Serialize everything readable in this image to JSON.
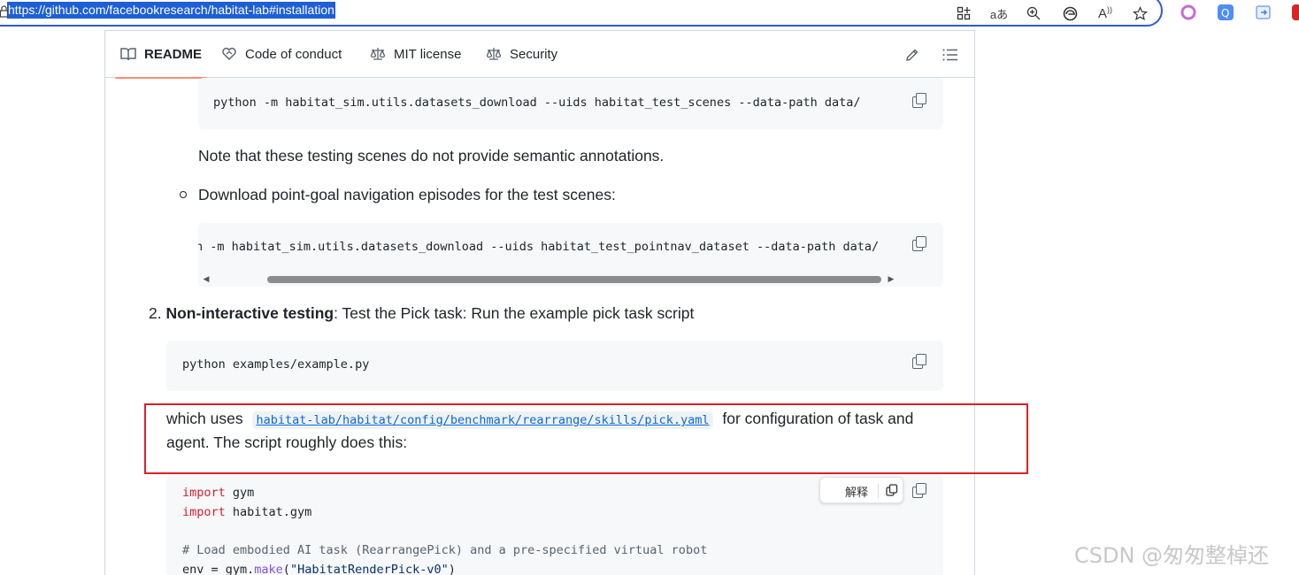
{
  "browser": {
    "url": "https://github.com/facebookresearch/habitat-lab#installation",
    "icons": [
      "apps-icon",
      "translate-icon",
      "zoom-icon",
      "edge-icon",
      "read-aloud-icon",
      "favorite-icon"
    ],
    "translate_label": "aあ",
    "read_aloud_label": "A",
    "accent_color": "#1e5fd6"
  },
  "tabs": [
    {
      "label": "README",
      "icon": "book-icon",
      "active": true
    },
    {
      "label": "Code of conduct",
      "icon": "heart-icon",
      "active": false
    },
    {
      "label": "MIT license",
      "icon": "law-icon",
      "active": false
    },
    {
      "label": "Security",
      "icon": "law-icon",
      "active": false
    }
  ],
  "content": {
    "code1": "python -m habitat_sim.utils.datasets_download --uids habitat_test_scenes --data-path data/",
    "note": "Note that these testing scenes do not provide semantic annotations.",
    "bullet2": "Download point-goal navigation episodes for the test scenes:",
    "code2": "n -m habitat_sim.utils.datasets_download --uids habitat_test_pointnav_dataset --data-path data/",
    "step2_number": "2.",
    "step2_bold": "Non-interactive testing",
    "step2_rest": ": Test the Pick task: Run the example pick task script",
    "code3": "python examples/example.py",
    "which_uses": "which uses",
    "config_link": "habitat-lab/habitat/config/benchmark/rearrange/skills/pick.yaml",
    "for_config": "for configuration of task and",
    "agent_line": "agent. The script roughly does this:",
    "code4": {
      "l1_kw": "import",
      "l1_rest": " gym",
      "l2_kw": "import",
      "l2_rest": " habitat.gym",
      "l3_comment": "# Load embodied AI task (RearrangePick) and a pre-specified virtual robot",
      "l4_a": "env = gym.",
      "l4_fn": "make",
      "l4_b": "(",
      "l4_str": "\"HabitatRenderPick-v0\"",
      "l4_c": ")"
    },
    "explain_label": "解释"
  },
  "watermark": "CSDN @匆匆整棹还",
  "colors": {
    "keyword": "#cf222e",
    "comment": "#59636e",
    "function": "#8250df",
    "string": "#0a3069",
    "link": "#0969da",
    "active_tab_underline": "#fd8c73",
    "highlight_box": "#d9212a"
  }
}
